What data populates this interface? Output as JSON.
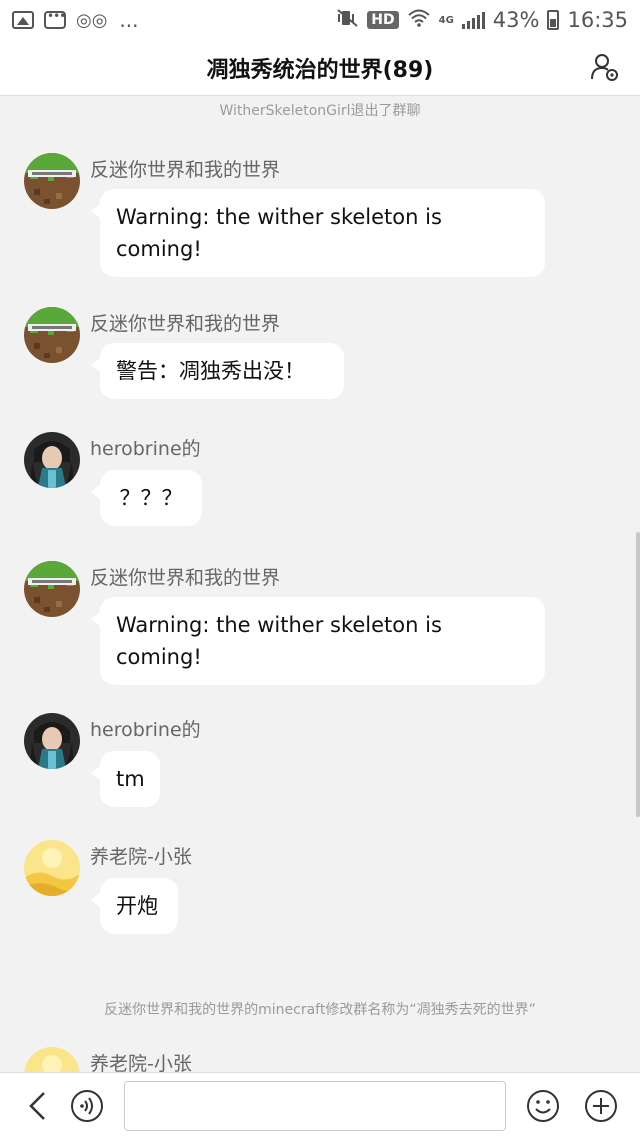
{
  "status_bar": {
    "left_more": "...",
    "hd": "HD",
    "network": "4G",
    "battery": "43%",
    "time": "16:35"
  },
  "header": {
    "title": "凋独秀统治的世界(89)"
  },
  "system_messages": [
    "WitherSkeletonGirl退出了群聊",
    "反迷你世界和我的世界的minecraft修改群名称为“凋独秀去死的世界”"
  ],
  "messages": [
    {
      "sender": "反迷你世界和我的世界",
      "avatar": "minecraft-grass-block",
      "lines": [
        "Warning: the wither skeleton is",
        "coming!"
      ]
    },
    {
      "sender": "反迷你世界和我的世界",
      "avatar": "minecraft-grass-block",
      "lines": [
        "警告：凋独秀出没！"
      ]
    },
    {
      "sender": "herobrine的",
      "avatar": "anime-character",
      "lines": [
        "？？？"
      ]
    },
    {
      "sender": "反迷你世界和我的世界",
      "avatar": "minecraft-grass-block",
      "lines": [
        "Warning: the wither skeleton is",
        "coming!"
      ]
    },
    {
      "sender": "herobrine的",
      "avatar": "anime-character",
      "lines": [
        "tm"
      ]
    },
    {
      "sender": "养老院-小张",
      "avatar": "yellow-landscape",
      "lines": [
        "开炮"
      ]
    },
    {
      "sender": "养老院-小张",
      "avatar": "yellow-landscape",
      "lines": []
    }
  ],
  "input": {
    "value": "",
    "placeholder": ""
  },
  "colors": {
    "chat_bg": "#f2f2f2",
    "bubble_bg": "#ffffff",
    "sender_text": "#666666",
    "system_text": "#9a9a9a"
  }
}
